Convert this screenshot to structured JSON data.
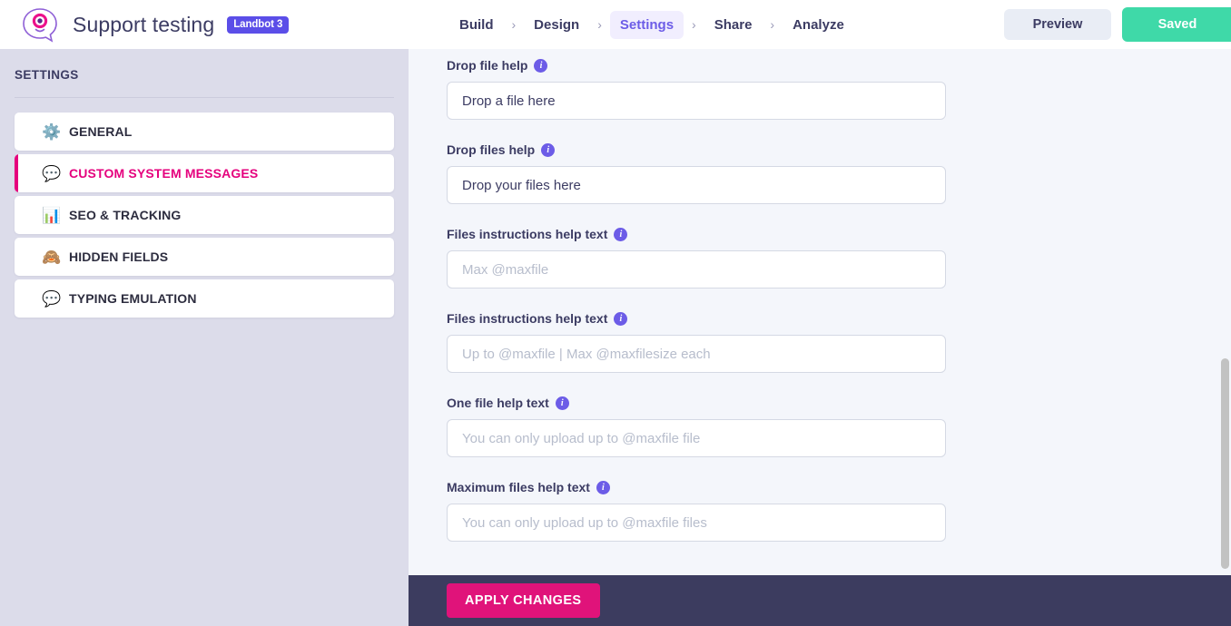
{
  "header": {
    "logo_icon": "landbot-chat-logo-icon",
    "title": "Support testing",
    "badge": "Landbot 3",
    "nav": [
      {
        "label": "Build",
        "active": false
      },
      {
        "label": "Design",
        "active": false
      },
      {
        "label": "Settings",
        "active": true
      },
      {
        "label": "Share",
        "active": false
      },
      {
        "label": "Analyze",
        "active": false
      }
    ],
    "separator": "›",
    "preview_label": "Preview",
    "saved_label": "Saved",
    "colors": {
      "badge_purple": "#5b4ee8",
      "nav_active": "#6c5ce7",
      "saved_green": "#3fd9a8",
      "preview_bg": "#e9edf5"
    }
  },
  "sidebar": {
    "title": "SETTINGS",
    "items": [
      {
        "label": "GENERAL",
        "icon": "gear-emoji",
        "glyph": "⚙️",
        "active": false
      },
      {
        "label": "CUSTOM SYSTEM MESSAGES",
        "icon": "speech-balloon-emoji",
        "glyph": "💬",
        "active": true
      },
      {
        "label": "SEO & TRACKING",
        "icon": "bar-chart-emoji",
        "glyph": "📊",
        "active": false
      },
      {
        "label": "HIDDEN FIELDS",
        "icon": "see-no-evil-monkey-emoji",
        "glyph": "🙈",
        "active": false
      },
      {
        "label": "TYPING EMULATION",
        "icon": "speech-balloon-emoji",
        "glyph": "💬",
        "active": false
      }
    ],
    "colors": {
      "background": "#dcdcea",
      "active_accent": "#e5007d"
    }
  },
  "main": {
    "info_icon_glyph": "i",
    "fields": [
      {
        "label": "Drop file help",
        "value": "Drop a file here",
        "placeholder": "",
        "name": "drop-file-help-input"
      },
      {
        "label": "Drop files help",
        "value": "Drop your files here",
        "placeholder": "",
        "name": "drop-files-help-input"
      },
      {
        "label": "Files instructions help text",
        "value": "",
        "placeholder": "Max @maxfile",
        "name": "files-instructions-help-text-input-1"
      },
      {
        "label": "Files instructions help text",
        "value": "",
        "placeholder": "Up to @maxfile | Max @maxfilesize each",
        "name": "files-instructions-help-text-input-2"
      },
      {
        "label": "One file help text",
        "value": "",
        "placeholder": "You can only upload up to @maxfile file",
        "name": "one-file-help-text-input"
      },
      {
        "label": "Maximum files help text",
        "value": "",
        "placeholder": "You can only upload up to @maxfile files",
        "name": "maximum-files-help-text-input"
      }
    ]
  },
  "footer": {
    "apply_label": "APPLY CHANGES",
    "background": "#3c3c5f",
    "button_color": "#e0137a"
  }
}
